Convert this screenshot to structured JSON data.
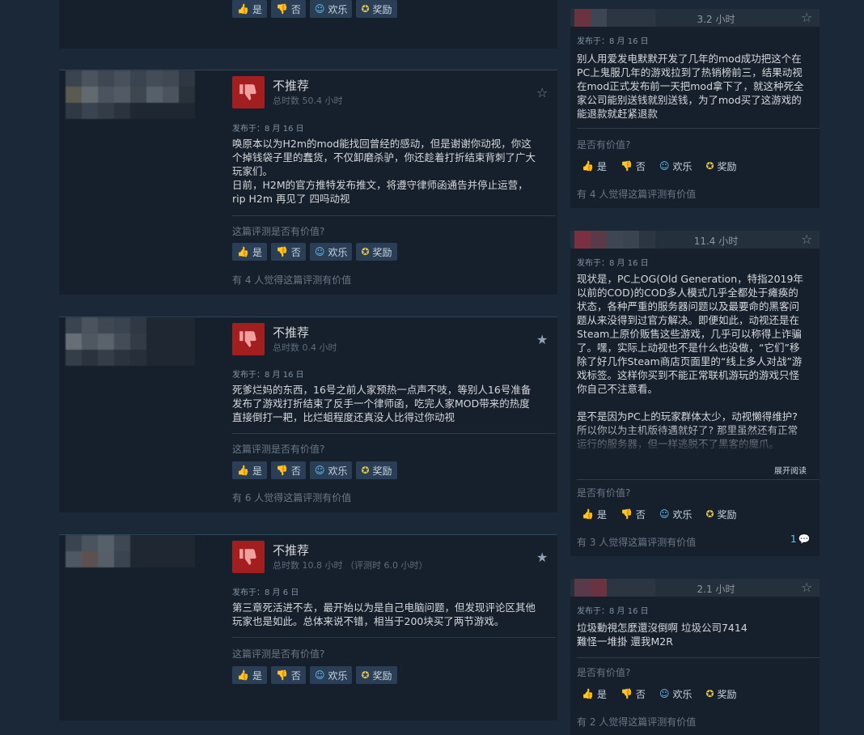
{
  "buttons": {
    "yes": "是",
    "no": "否",
    "funny": "欢乐",
    "award": "奖励"
  },
  "icons": {
    "yes": "thumbs-up-icon",
    "no": "thumbs-down-icon",
    "funny": "smiley-icon",
    "award": "award-ribbon-icon",
    "favorite": "star-icon",
    "thumb_review": "thumbs-down-icon",
    "comment": "speech-bubble-icon"
  },
  "colors": {
    "background": "#1b2838",
    "card": "#16202d",
    "not_recommended": "#a31f1f",
    "accent": "#67c1f5",
    "award": "#e5c150"
  },
  "left_reviews": [
    {
      "partial": true,
      "helpful_question": "",
      "helpful_count": ""
    },
    {
      "verdict": "不推荐",
      "hours": "总时数 50.4 小时",
      "posted": "发布于：8 月 16 日",
      "text": "唤原本以为H2m的mod能找回曾经的感动，但是谢谢你动视，你这\n个掉钱袋子里的蠢货，不仅卸磨杀驴，你还趁着打折结束背刺了广大\n玩家们。\n日前，H2M的官方推特发布推文，将遵守律师函通告并停止运营，\nrip H2m 再见了 四吗动视",
      "helpful_question": "这篇评测是否有价值?",
      "helpful_count": "有 4 人觉得这篇评测有价值"
    },
    {
      "verdict": "不推荐",
      "hours": "总时数 0.4 小时",
      "posted": "发布于：8 月 16 日",
      "text": "死爹烂妈的东西，16号之前人家预热一点声不吱，等别人16号准备\n发布了游戏打折结束了反手一个律师函，吃完人家MOD带来的热度\n直接倒打一耙，比烂蛆程度还真没人比得过你动视",
      "helpful_question": "这篇评测是否有价值?",
      "helpful_count": "有 6 人觉得这篇评测有价值"
    },
    {
      "verdict": "不推荐",
      "hours": "总时数 10.8 小时 （评测时 6.0 小时）",
      "posted": "发布于：8 月 6 日",
      "text": "第三章死活进不去，最开始以为是自己电脑问题，但发现评论区其他\n玩家也是如此。总体来说不错，相当于200块买了两节游戏。",
      "helpful_question": "这篇评测是否有价值?",
      "helpful_count": ""
    }
  ],
  "right_reviews": [
    {
      "hours": "3.2 小时",
      "posted": "发布于：8 月 16 日",
      "text": "别人用爱发电默默开发了几年的mod成功把这个在\nPC上鬼服几年的游戏拉到了热销榜前三，结果动视\n在mod正式发布前一天把mod拿下了，就这种死全\n家公司能别送钱就别送钱，为了mod买了这游戏的\n能退款就赶紧退款",
      "helpful_question": "是否有价值?",
      "helpful_count": "有 4 人觉得这篇评测有价值"
    },
    {
      "hours": "11.4 小时",
      "posted": "发布于：8 月 16 日",
      "text": "现状是，PC上OG(Old Generation，特指2019年\n以前的COD)的COD多人模式几乎全都处于瘫痪的\n状态，各种严重的服务器问题以及最要命的黑客问\n题从来没得到过官方解决。即便如此，动视还是在\nSteam上原价贩售这些游戏，几乎可以称得上诈骗\n了。嘿，实际上动视也不是什么也没做，“它们”移\n除了好几作Steam商店页面里的“线上多人对战”游\n戏标签。这样你买到不能正常联机游玩的游戏只怪\n你自己不注意看。\n\n是不是因为PC上的玩家群体太少，动视懒得维护?\n所以你以为主机版待遇就好了? 那里虽然还有正常\n运行的服务器，但一样逃脱不了黑客的魔爪。",
      "expand": "展开阅读",
      "helpful_question": "是否有价值?",
      "helpful_count": "有 3 人觉得这篇评测有价值",
      "comments": "1"
    },
    {
      "hours": "2.1 小时",
      "posted": "发布于：8 月 16 日",
      "text": "垃圾動視怎麼還沒倒啊 垃圾公司7414\n難怪一堆掛 還我M2R",
      "helpful_question": "是否有价值?",
      "helpful_count": "有 2 人觉得这篇评测有价值"
    }
  ]
}
